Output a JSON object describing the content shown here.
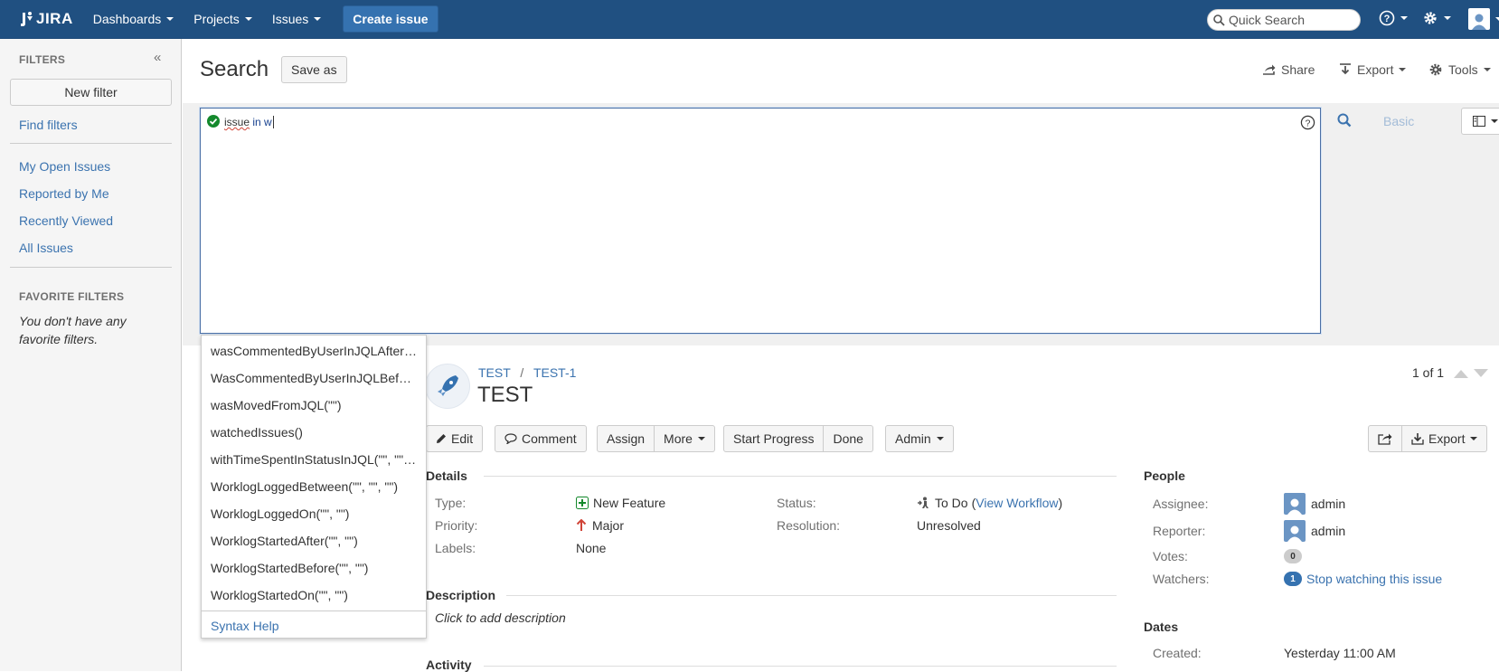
{
  "nav": {
    "logo": "JIRA",
    "items": [
      {
        "label": "Dashboards"
      },
      {
        "label": "Projects"
      },
      {
        "label": "Issues"
      }
    ],
    "create": "Create issue",
    "quick_search_placeholder": "Quick Search"
  },
  "sidebar": {
    "filters_heading": "FILTERS",
    "new_filter": "New filter",
    "find_filters": "Find filters",
    "links": [
      "My Open Issues",
      "Reported by Me",
      "Recently Viewed",
      "All Issues"
    ],
    "favorites_heading": "FAVORITE FILTERS",
    "favorites_empty": "You don't have any favorite filters."
  },
  "header": {
    "title": "Search",
    "save_as": "Save as",
    "share": "Share",
    "export": "Export",
    "tools": "Tools"
  },
  "jql": {
    "query_word": "issue",
    "query_rest": " in w",
    "basic": "Basic"
  },
  "suggestions": {
    "items": [
      "wasCommentedByUserInJQLAfter(\"\", \"\")",
      "WasCommentedByUserInJQLBefore(\"\", \"\")",
      "wasMovedFromJQL(\"\")",
      "watchedIssues()",
      "withTimeSpentInStatusInJQL(\"\", \"\", \"\")",
      "WorklogLoggedBetween(\"\", \"\", \"\")",
      "WorklogLoggedOn(\"\", \"\")",
      "WorklogStartedAfter(\"\", \"\")",
      "WorklogStartedBefore(\"\", \"\")",
      "WorklogStartedOn(\"\", \"\")"
    ],
    "syntax_help": "Syntax Help"
  },
  "issue": {
    "project": "TEST",
    "key": "TEST-1",
    "summary": "TEST",
    "counter": "1 of 1",
    "ops": {
      "edit": "Edit",
      "comment": "Comment",
      "assign": "Assign",
      "more": "More",
      "start_progress": "Start Progress",
      "done": "Done",
      "admin": "Admin",
      "export": "Export"
    },
    "details": {
      "heading": "Details",
      "type_label": "Type:",
      "type_value": "New Feature",
      "priority_label": "Priority:",
      "priority_value": "Major",
      "labels_label": "Labels:",
      "labels_value": "None",
      "status_label": "Status:",
      "status_value": "To Do",
      "view_workflow": "View Workflow",
      "resolution_label": "Resolution:",
      "resolution_value": "Unresolved"
    },
    "description": {
      "heading": "Description",
      "placeholder": "Click to add description"
    },
    "activity_heading": "Activity",
    "people": {
      "heading": "People",
      "assignee_label": "Assignee:",
      "assignee": "admin",
      "reporter_label": "Reporter:",
      "reporter": "admin",
      "votes_label": "Votes:",
      "votes": "0",
      "watchers_label": "Watchers:",
      "watchers": "1",
      "stop_watching": "Stop watching this issue"
    },
    "dates": {
      "heading": "Dates",
      "created_label": "Created:",
      "created": "Yesterday 11:00 AM"
    }
  },
  "colors": {
    "nav_bg": "#205081",
    "link": "#3b73af",
    "success": "#14892c"
  }
}
